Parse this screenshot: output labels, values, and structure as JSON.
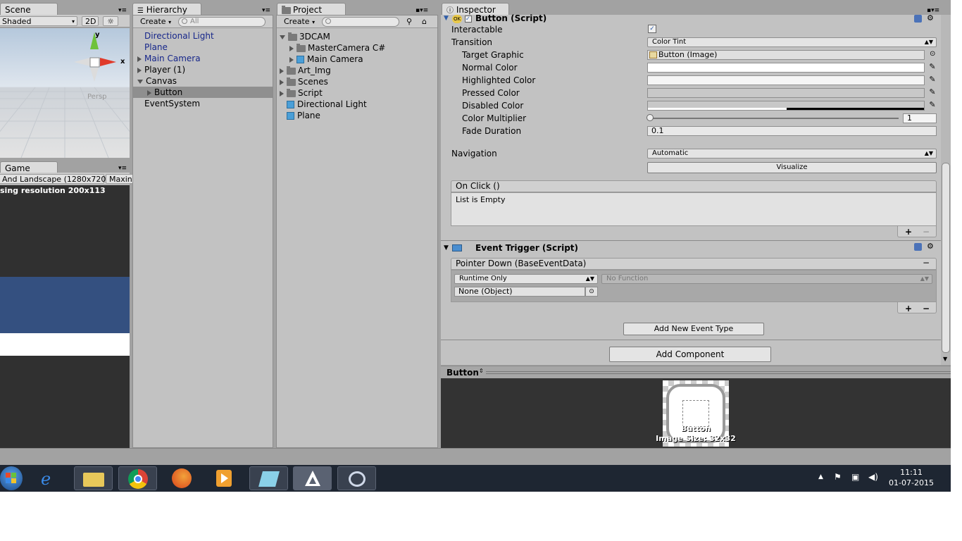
{
  "scene": {
    "tab": "Scene",
    "shading": "Shaded",
    "mode_2d": "2D",
    "persp": "Persp",
    "gizmo_y": "y",
    "gizmo_x": "x"
  },
  "game": {
    "tab": "Game",
    "resolution": "And Landscape (1280x720)",
    "maximize": "Maxin",
    "notice": "sing resolution 200x113"
  },
  "hierarchy": {
    "tab": "Hierarchy",
    "create": "Create",
    "search_placeholder": "All",
    "items": [
      {
        "label": "Directional Light"
      },
      {
        "label": "Plane"
      },
      {
        "label": "Main Camera"
      },
      {
        "label": "Player (1)"
      },
      {
        "label": "Canvas"
      },
      {
        "label": "Button"
      },
      {
        "label": "EventSystem"
      }
    ]
  },
  "project": {
    "tab": "Project",
    "create": "Create",
    "items": [
      {
        "label": "3DCAM"
      },
      {
        "label": "MasterCamera C#"
      },
      {
        "label": "Main Camera"
      },
      {
        "label": "Art_Img"
      },
      {
        "label": "Scenes"
      },
      {
        "label": "Script"
      },
      {
        "label": "Directional Light"
      },
      {
        "label": "Plane"
      }
    ]
  },
  "inspector": {
    "tab": "Inspector",
    "button_script": {
      "title": "Button (Script)",
      "interactable": "Interactable",
      "transition": "Transition",
      "transition_value": "Color Tint",
      "target_graphic": "Target Graphic",
      "target_graphic_value": "Button (Image)",
      "normal_color": "Normal Color",
      "highlighted_color": "Highlighted Color",
      "pressed_color": "Pressed Color",
      "disabled_color": "Disabled Color",
      "color_multiplier": "Color Multiplier",
      "color_multiplier_value": "1",
      "fade_duration": "Fade Duration",
      "fade_duration_value": "0.1",
      "navigation": "Navigation",
      "navigation_value": "Automatic",
      "visualize": "Visualize",
      "on_click": "On Click ()",
      "list_empty": "List is Empty",
      "plus": "+",
      "minus": "−"
    },
    "event_trigger": {
      "title": "Event Trigger (Script)",
      "pointer_down": "Pointer Down (BaseEventData)",
      "runtime": "Runtime Only",
      "no_function": "No Function",
      "none_object": "None (Object)",
      "add_event": "Add New Event Type"
    },
    "add_component": "Add Component"
  },
  "preview": {
    "title": "Button",
    "image_name": "Button",
    "image_size": "Image Size: 32x32"
  },
  "taskbar": {
    "time": "11:11",
    "date": "01-07-2015"
  }
}
